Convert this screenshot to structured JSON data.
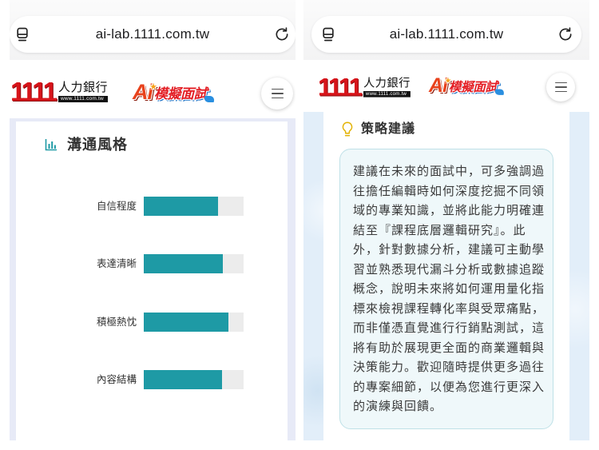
{
  "browser": {
    "url": "ai-lab.1111.com.tw",
    "tabs_icon": "tabs-icon",
    "reload_icon": "reload-icon"
  },
  "logos": {
    "brand_number": "1111",
    "brand_name": "人力銀行",
    "brand_url": "www.1111.com.tw",
    "product_ai": "Ai",
    "product_name": "模擬面試"
  },
  "header": {
    "menu_icon": "hamburger-menu-icon"
  },
  "colors": {
    "brand_red": "#d7141a",
    "accent_teal": "#1e9aa5",
    "bar_track": "#ececec",
    "bulb_yellow": "#e2b100",
    "advice_bg": "#eff8fa"
  },
  "communication": {
    "title": "溝通風格",
    "icon": "bar-chart-icon",
    "bars": [
      {
        "label": "自信程度",
        "level": 0.74
      },
      {
        "label": "表達清晰",
        "level": 0.79
      },
      {
        "label": "積極熱忱",
        "level": 0.85
      },
      {
        "label": "內容結構",
        "level": 0.78
      }
    ]
  },
  "strategy": {
    "title": "策略建議",
    "icon": "lightbulb-icon",
    "text": "建議在未來的面試中，可多強調過\n往擔任編輯時如何深度挖掘不同領\n域的專業知識，並將此能力明確連\n結至『課程底層邏輯研究』。此\n外，針對數據分析，建議可主動學\n習並熟悉現代漏斗分析或數據追蹤\n概念，說明未來將如何運用量化指\n標來檢視課程轉化率與受眾痛點，\n而非僅憑直覺進行行銷點測試，這\n將有助於展現更全面的商業邏輯與\n決策能力。歡迎隨時提供更多過往\n的專案細節，以便為您進行更深入\n的演練與回饋。"
  }
}
